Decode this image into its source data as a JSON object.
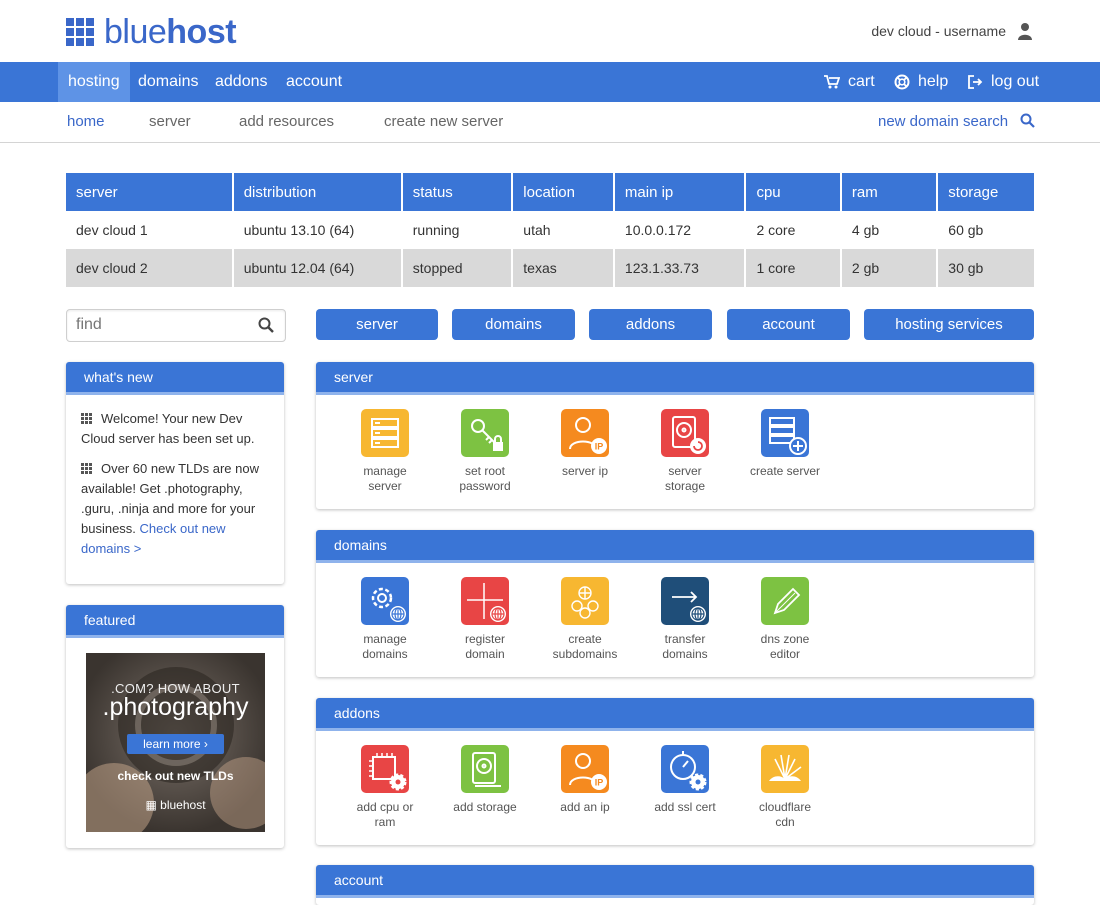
{
  "brand": {
    "logo_prefix": "blue",
    "logo_suffix": "host"
  },
  "user": {
    "label": "dev cloud - username",
    "icon": "user-icon"
  },
  "main_nav": {
    "left": [
      "hosting",
      "domains",
      "addons",
      "account"
    ],
    "cart": "cart",
    "help": "help",
    "logout": "log out"
  },
  "sub_nav": {
    "items": [
      "home",
      "server",
      "add resources",
      "create new server"
    ],
    "search": "new domain search"
  },
  "servers_table": {
    "headers": [
      "server",
      "distribution",
      "status",
      "location",
      "main ip",
      "cpu",
      "ram",
      "storage"
    ],
    "rows": [
      [
        "dev cloud 1",
        "ubuntu 13.10 (64)",
        "running",
        "utah",
        "10.0.0.172",
        "2 core",
        "4 gb",
        "60 gb"
      ],
      [
        "dev cloud 2",
        "ubuntu 12.04 (64)",
        "stopped",
        "texas",
        "123.1.33.73",
        "1 core",
        "2 gb",
        "30 gb"
      ]
    ]
  },
  "find": {
    "placeholder": "find"
  },
  "quick_buttons": [
    "server",
    "domains",
    "addons",
    "account",
    "hosting services"
  ],
  "whats_new": {
    "title": "what's new",
    "item1": "Welcome! Your new Dev Cloud server has been set up.",
    "item2": "Over 60 new TLDs are now available! Get .photography, .guru, .ninja and more for your business.",
    "item2_link": "Check out new domains >"
  },
  "featured": {
    "title": "featured",
    "line1": ".COM? HOW ABOUT",
    "line2": ".photography",
    "button": "learn more",
    "line3": "check out new TLDs",
    "brand": "bluehost"
  },
  "sections": [
    {
      "title": "server",
      "tiles": [
        {
          "line1": "manage",
          "line2": "server",
          "color": "#f7b731",
          "icon": "server-rack-icon"
        },
        {
          "line1": "set root",
          "line2": "password",
          "color": "#7dc242",
          "icon": "key-lock-icon"
        },
        {
          "line1": "server ip",
          "line2": "",
          "color": "#f58a1f",
          "icon": "person-ip-icon"
        },
        {
          "line1": "server",
          "line2": "storage",
          "color": "#e84545",
          "icon": "disk-refresh-icon"
        },
        {
          "line1": "create server",
          "line2": "",
          "color": "#3a75d6",
          "icon": "server-add-icon"
        }
      ]
    },
    {
      "title": "domains",
      "tiles": [
        {
          "line1": "manage",
          "line2": "domains",
          "color": "#3a75d6",
          "icon": "gear-globe-icon"
        },
        {
          "line1": "register",
          "line2": "domain",
          "color": "#e84545",
          "icon": "plus-globe-icon"
        },
        {
          "line1": "create",
          "line2": "subdomains",
          "color": "#f7b731",
          "icon": "globe-cluster-icon"
        },
        {
          "line1": "transfer",
          "line2": "domains",
          "color": "#1f4e79",
          "icon": "arrow-globe-icon"
        },
        {
          "line1": "dns zone",
          "line2": "editor",
          "color": "#7dc242",
          "icon": "pen-icon"
        }
      ]
    },
    {
      "title": "addons",
      "tiles": [
        {
          "line1": "add cpu or",
          "line2": "ram",
          "color": "#e84545",
          "icon": "chip-gear-icon"
        },
        {
          "line1": "add storage",
          "line2": "",
          "color": "#7dc242",
          "icon": "disk-add-icon"
        },
        {
          "line1": "add an ip",
          "line2": "",
          "color": "#f58a1f",
          "icon": "person-ip-icon"
        },
        {
          "line1": "add ssl cert",
          "line2": "",
          "color": "#3a75d6",
          "icon": "gauge-gear-icon"
        },
        {
          "line1": "cloudflare",
          "line2": "cdn",
          "color": "#f7b731",
          "icon": "cloudflare-icon"
        }
      ]
    },
    {
      "title": "account",
      "tiles": []
    }
  ]
}
